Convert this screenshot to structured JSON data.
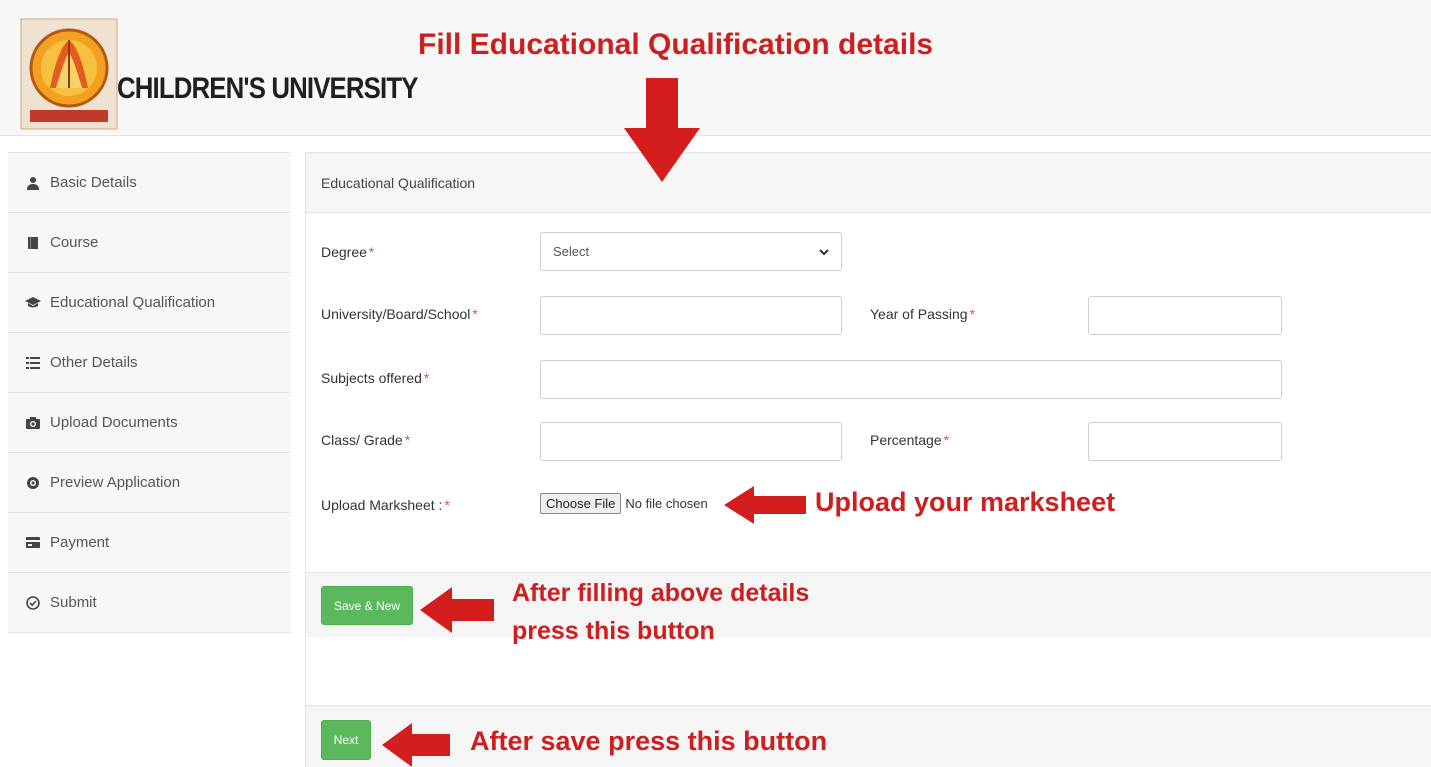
{
  "header": {
    "brand": "CHILDREN'S UNIVERSITY",
    "logo_alt": "Children's University emblem"
  },
  "sidebar": {
    "items": [
      {
        "label": "Basic Details",
        "icon": "user-icon"
      },
      {
        "label": "Course",
        "icon": "book-icon"
      },
      {
        "label": "Educational Qualification",
        "icon": "graduation-cap-icon"
      },
      {
        "label": "Other Details",
        "icon": "list-icon"
      },
      {
        "label": "Upload Documents",
        "icon": "camera-icon"
      },
      {
        "label": "Preview Application",
        "icon": "eye-icon"
      },
      {
        "label": "Payment",
        "icon": "credit-card-icon"
      },
      {
        "label": "Submit",
        "icon": "check-circle-icon"
      }
    ]
  },
  "panel": {
    "title": "Educational Qualification"
  },
  "form": {
    "degree_label": "Degree",
    "degree_value": "Select",
    "university_label": "University/Board/School",
    "university_value": "",
    "year_label": "Year of Passing",
    "year_value": "",
    "subjects_label": "Subjects offered",
    "subjects_value": "",
    "class_label": "Class/ Grade",
    "class_value": "",
    "percentage_label": "Percentage",
    "percentage_value": "",
    "upload_label": "Upload Marksheet :",
    "file_button": "Choose File",
    "file_status": "No file chosen",
    "required_mark": "*"
  },
  "buttons": {
    "save_new": "Save & New",
    "next": "Next"
  },
  "annotations": {
    "top": "Fill Educational Qualification details",
    "upload": "Upload your marksheet",
    "save_line1": "After filling above details",
    "save_line2": "press this button",
    "next": "After save press this button"
  },
  "colors": {
    "annotation_red": "#cc1f1f",
    "button_green": "#5cb85c",
    "required_red": "#d9534f"
  }
}
